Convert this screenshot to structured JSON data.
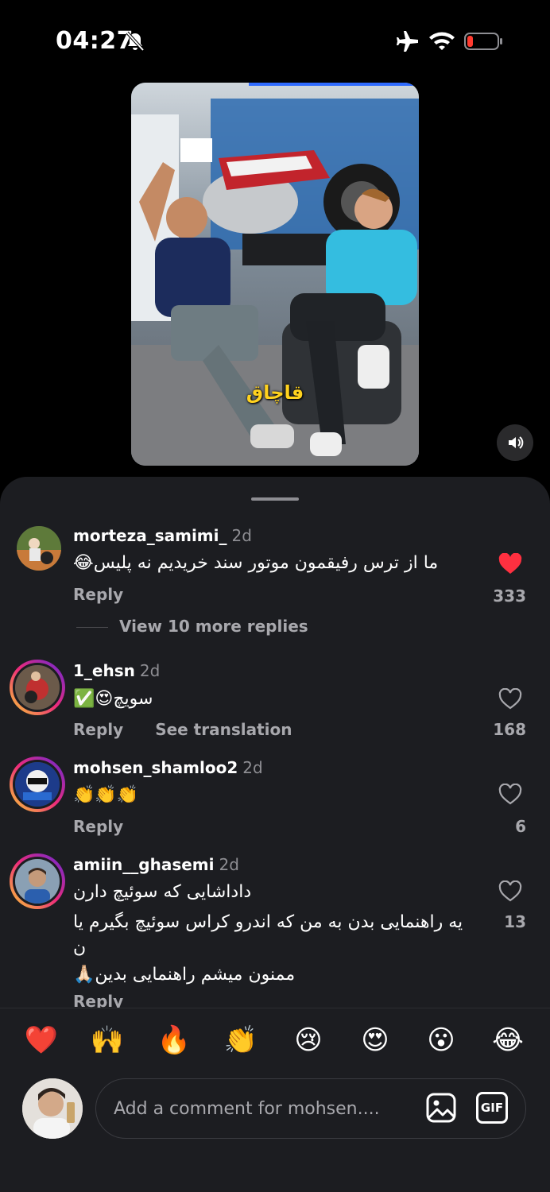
{
  "status": {
    "time": "04:27"
  },
  "video": {
    "caption": "قاچاق"
  },
  "comments": [
    {
      "username": "morteza_samimi_",
      "ago": "2d",
      "lines": [
        "ما از ترس رفیقمون موتور سند خریدیم نه پلیس😂"
      ],
      "reply": "Reply",
      "likes": "333",
      "liked": true
    },
    {
      "username": "1_ehsn",
      "ago": "2d",
      "lines": [
        "سویچ😍✅"
      ],
      "reply": "Reply",
      "see_translation": "See translation",
      "likes": "168",
      "liked": false
    },
    {
      "username": "mohsen_shamloo2",
      "ago": "2d",
      "lines": [
        "👏👏👏"
      ],
      "reply": "Reply",
      "likes": "6",
      "liked": false
    },
    {
      "username": "amiin__ghasemi",
      "ago": "2d",
      "lines": [
        "داداشایی که سوئیچ دارن",
        "یه راهنمایی بدن به من که اندرو کراس سوئیچ بگیرم یا",
        "ن",
        "ممنون میشم راهنمایی بدین🙏🏻"
      ],
      "reply": "Reply",
      "likes": "13",
      "liked": false
    }
  ],
  "view_more": "View 10 more replies",
  "quick_emojis": [
    "❤️",
    "🙌",
    "🔥",
    "👏",
    "😢",
    "😍",
    "😮",
    "😂"
  ],
  "composer": {
    "placeholder": "Add a comment for mohsen....",
    "gif_label": "GIF"
  },
  "colors": {
    "accent_like": "#ff3040",
    "progress": "#2f6bff",
    "caption": "#ffd21e"
  }
}
